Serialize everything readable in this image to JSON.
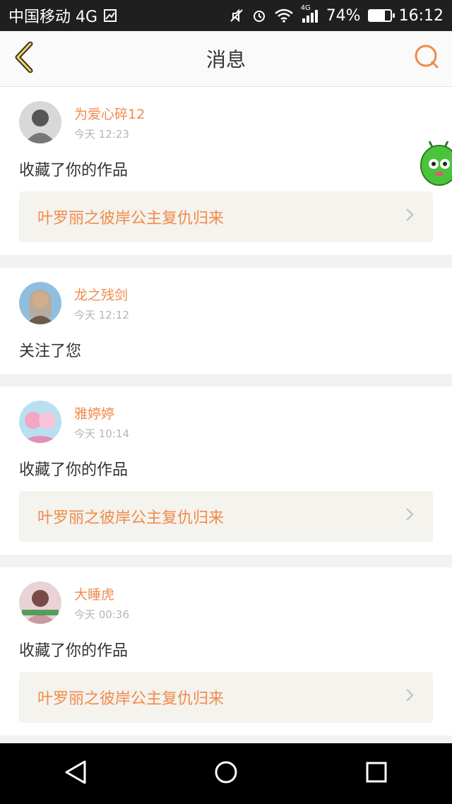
{
  "status_bar": {
    "carrier": "中国移动 4G",
    "network_badge": "4G",
    "battery_text": "74%",
    "battery_level": 0.74,
    "time": "16:12",
    "icons": [
      "image-icon",
      "mute-icon",
      "alarm-icon",
      "wifi-icon",
      "signal-icon",
      "battery-icon"
    ]
  },
  "header": {
    "title": "消息",
    "back_icon": "chevron-left-icon",
    "search_icon": "search-icon"
  },
  "colors": {
    "accent": "#f08a4b",
    "link_bg": "#f4f3ee",
    "page_bg": "#f2f2f2"
  },
  "messages": [
    {
      "username": "为爱心碎12",
      "time": "今天 12:23",
      "action": "收藏了你的作品",
      "work_title": "叶罗丽之彼岸公主复仇归来",
      "avatar_colors": [
        "#555555",
        "#d8d8d8"
      ]
    },
    {
      "username": "龙之残剑",
      "time": "今天 12:12",
      "action": "关注了您",
      "avatar_colors": [
        "#8fbfe0",
        "#c9a27e"
      ]
    },
    {
      "username": "雅婷婷",
      "time": "今天 10:14",
      "action": "收藏了你的作品",
      "work_title": "叶罗丽之彼岸公主复仇归来",
      "avatar_colors": [
        "#f3a6c8",
        "#b8e0f0"
      ]
    },
    {
      "username": "大睡虎",
      "time": "今天 00:36",
      "action": "收藏了你的作品",
      "work_title": "叶罗丽之彼岸公主复仇归来",
      "avatar_colors": [
        "#c79aa0",
        "#7a4a4a"
      ]
    }
  ],
  "nav": {
    "icons": [
      "back-triangle-icon",
      "home-circle-icon",
      "recents-square-icon"
    ]
  }
}
